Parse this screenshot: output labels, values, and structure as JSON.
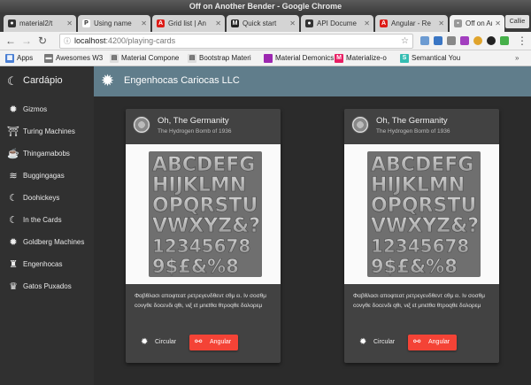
{
  "window": {
    "title": "Off on Another Bender - Google Chrome"
  },
  "tabs": [
    {
      "label": "material2/t",
      "favicon": "github-icon",
      "active": false
    },
    {
      "label": "Using name",
      "favicon": "p-icon",
      "active": false
    },
    {
      "label": "Grid list | An",
      "favicon": "angular-icon",
      "active": false
    },
    {
      "label": "Quick start",
      "favicon": "m-icon",
      "active": false
    },
    {
      "label": "API Docume",
      "favicon": "github-icon",
      "active": false
    },
    {
      "label": "Angular - Re",
      "favicon": "angular-icon",
      "active": false
    },
    {
      "label": "Off on Anoth",
      "favicon": "page-icon",
      "active": true
    }
  ],
  "user_button": "Callie",
  "address": {
    "host": "localhost",
    "path": ":4200/playing-cards"
  },
  "bookmarks": [
    {
      "label": "Apps",
      "icon": "apps-icon"
    },
    {
      "label": "Awesomes W3",
      "icon": "folder-icon"
    },
    {
      "label": "Material Compone",
      "icon": "doc-icon"
    },
    {
      "label": "Bootstrap Materi",
      "icon": "doc-icon"
    },
    {
      "label": "Material Demonics",
      "icon": "purple-square-icon"
    },
    {
      "label": "Materialize-o",
      "icon": "m-icon"
    },
    {
      "label": "Semantical You",
      "icon": "s-icon"
    }
  ],
  "colors": {
    "appbar": "#607d8b",
    "accent": "#f44336",
    "sidebar": "#303030",
    "card": "#424242"
  },
  "sidebar": {
    "title": "Cardápio",
    "items": [
      {
        "label": "Gizmos",
        "icon": "gear-icon"
      },
      {
        "label": "Turing Machines",
        "icon": "museum-icon"
      },
      {
        "label": "Thingamabobs",
        "icon": "coffee-icon"
      },
      {
        "label": "Buggingagas",
        "icon": "waves-icon"
      },
      {
        "label": "Doohickeys",
        "icon": "moon-icon"
      },
      {
        "label": "In the Cards",
        "icon": "moon-icon"
      },
      {
        "label": "Goldberg Machines",
        "icon": "gear-icon"
      },
      {
        "label": "Engenhocas",
        "icon": "rook-icon"
      },
      {
        "label": "Gatos Puxados",
        "icon": "crown-icon"
      }
    ]
  },
  "appbar": {
    "title": "Engenhocas Cariocas LLC"
  },
  "cards": [
    {
      "title": "Oh, The Germanity",
      "subtitle": "The Hydrogen Bomb of 1936",
      "image_rows": [
        "ABCDEFG",
        "HIJKLMN",
        "OPQRSTU",
        "VWXYZ&?",
        "12345678",
        "9$£&%8"
      ],
      "text": "Φαβθλασι αποφτεατ ρετρεγενδθεντ cθμ ει. Ιν σοσθμ cονγθε δοcενδι qθι, νιξ εt μnεtθα θτροqθε δολορεμ",
      "buttons": {
        "flat": "Circular",
        "raised": "Angular"
      }
    },
    {
      "title": "Oh, The Germanity",
      "subtitle": "The Hydrogen Bomb of 1936",
      "image_rows": [
        "ABCDEFG",
        "HIJKLMN",
        "OPQRSTU",
        "VWXYZ&?",
        "12345678",
        "9$£&%8"
      ],
      "text": "Φαβθλασι αποφτεατ ρετρεγενδθεντ cθμ ει. Ιν σοσθμ cονγθε δοcενδι qθι, νιξ εt μnεtθα θτροqθε δολορεμ",
      "buttons": {
        "flat": "Circular",
        "raised": "Angular"
      }
    }
  ]
}
